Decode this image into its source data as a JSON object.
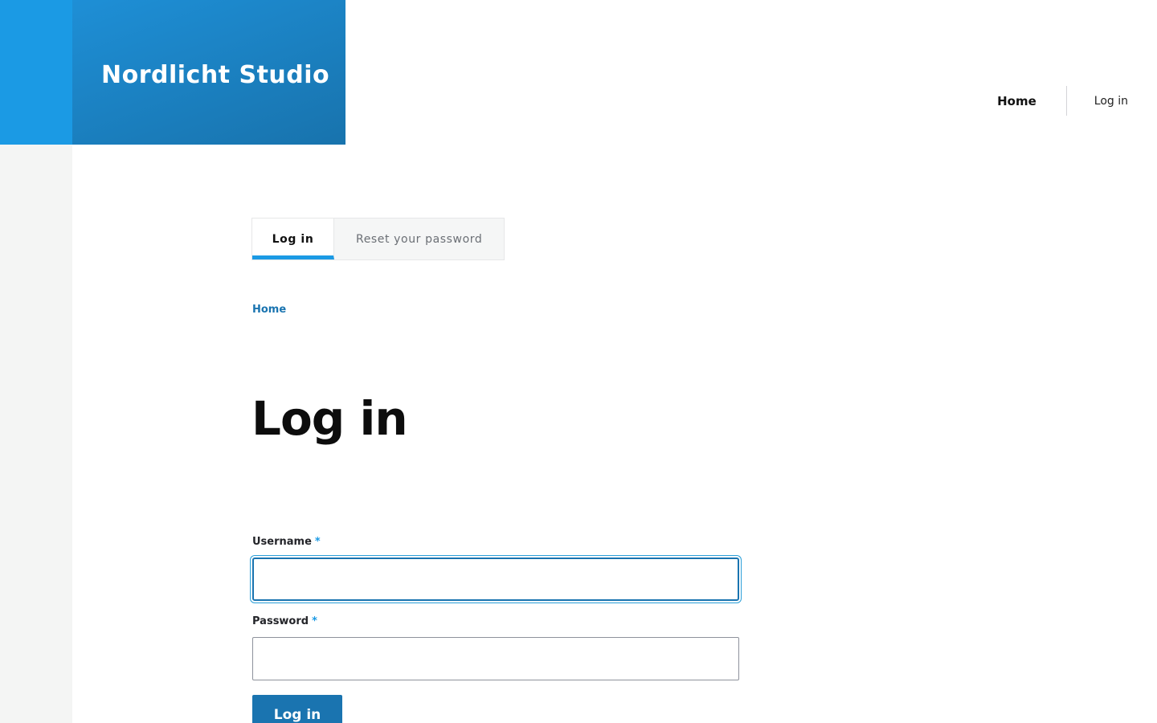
{
  "header": {
    "site_name": "Nordlicht Studio"
  },
  "main_nav": {
    "items": [
      {
        "label": "Home",
        "active": true
      },
      {
        "label": "Log in",
        "active": false
      }
    ]
  },
  "tabs": [
    {
      "label": "Log in",
      "active": true
    },
    {
      "label": "Reset your password",
      "active": false
    }
  ],
  "breadcrumb": {
    "items": [
      {
        "label": "Home"
      }
    ]
  },
  "page": {
    "title": "Log in"
  },
  "form": {
    "username": {
      "label": "Username",
      "required_marker": "*",
      "value": "",
      "placeholder": ""
    },
    "password": {
      "label": "Password",
      "required_marker": "*",
      "value": "",
      "placeholder": ""
    },
    "submit_label": "Log in"
  },
  "colors": {
    "brand_blue": "#1b9ae4",
    "brand_dark_blue": "#1a74b0",
    "rail_grey": "#f4f5f4"
  }
}
